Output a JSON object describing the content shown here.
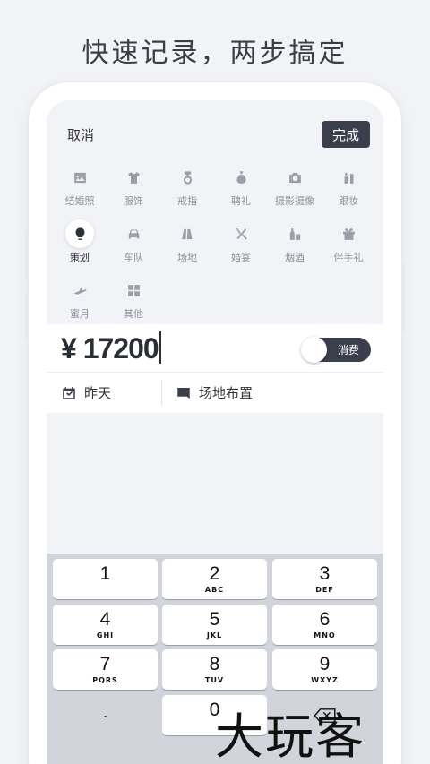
{
  "headline": "快速记录，两步搞定",
  "topbar": {
    "cancel_label": "取消",
    "done_label": "完成"
  },
  "categories": [
    {
      "label": "结婚照",
      "icon": "photo-icon"
    },
    {
      "label": "服饰",
      "icon": "shirt-icon"
    },
    {
      "label": "戒指",
      "icon": "ring-icon"
    },
    {
      "label": "聘礼",
      "icon": "money-bag-icon"
    },
    {
      "label": "摄影摄像",
      "icon": "camera-icon"
    },
    {
      "label": "跟妆",
      "icon": "makeup-icon"
    },
    {
      "label": "策划",
      "icon": "lightbulb-icon",
      "selected": true
    },
    {
      "label": "车队",
      "icon": "car-icon"
    },
    {
      "label": "场地",
      "icon": "map-icon"
    },
    {
      "label": "婚宴",
      "icon": "fork-knife-icon"
    },
    {
      "label": "烟酒",
      "icon": "bottle-icon"
    },
    {
      "label": "伴手礼",
      "icon": "gift-icon"
    },
    {
      "label": "蜜月",
      "icon": "airplane-icon"
    },
    {
      "label": "其他",
      "icon": "grid-icon"
    }
  ],
  "amount": {
    "currency": "¥",
    "value": "17200"
  },
  "toggle": {
    "label": "消费",
    "on": true
  },
  "meta": {
    "date_label": "昨天",
    "note_label": "场地布置"
  },
  "keyboard": {
    "keys": [
      {
        "digit": "1",
        "letters": ""
      },
      {
        "digit": "2",
        "letters": "ABC"
      },
      {
        "digit": "3",
        "letters": "DEF"
      },
      {
        "digit": "4",
        "letters": "GHI"
      },
      {
        "digit": "5",
        "letters": "JKL"
      },
      {
        "digit": "6",
        "letters": "MNO"
      },
      {
        "digit": "7",
        "letters": "PQRS"
      },
      {
        "digit": "8",
        "letters": "TUV"
      },
      {
        "digit": "9",
        "letters": "WXYZ"
      },
      {
        "digit": ".",
        "letters": ""
      },
      {
        "digit": "0",
        "letters": ""
      }
    ],
    "backspace_icon": "backspace-icon"
  },
  "watermark": "大玩客",
  "colors": {
    "accent": "#3b3f4c",
    "background": "#f2f3f6",
    "icon": "#9aa0aa"
  }
}
